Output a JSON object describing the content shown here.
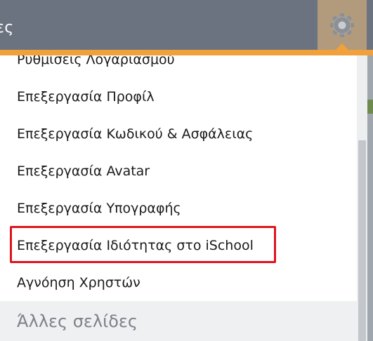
{
  "header": {
    "title_fragment": "ες",
    "settings_icon": "gear-icon"
  },
  "menu": {
    "items": [
      {
        "label": "Ρυθμίσεις Λογαριασμού"
      },
      {
        "label": "Επεξεργασία Προφίλ"
      },
      {
        "label": "Επεξεργασία Κωδικού & Ασφάλειας"
      },
      {
        "label": "Επεξεργασία Avatar"
      },
      {
        "label": "Επεξεργασία Υπογραφής"
      },
      {
        "label": "Επεξεργασία Ιδιότητας στο iSchool",
        "highlighted": true
      },
      {
        "label": "Αγνόηση Χρηστών"
      }
    ],
    "section_title": "Άλλες σελίδες"
  },
  "colors": {
    "header_bg": "#6b7380",
    "accent_orange": "#f0a13b",
    "highlight_border": "#e0141c",
    "gear_button_bg": "#b29a7c"
  }
}
